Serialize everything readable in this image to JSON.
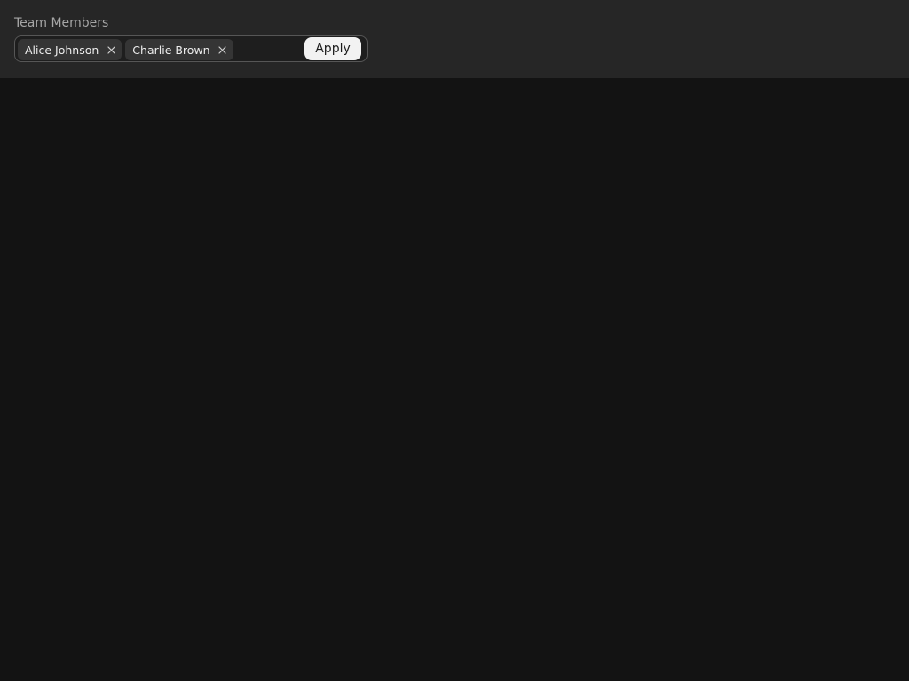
{
  "filter": {
    "label": "Team Members",
    "tags": [
      {
        "label": "Alice Johnson",
        "remove_icon": "close-icon"
      },
      {
        "label": "Charlie Brown",
        "remove_icon": "close-icon"
      }
    ],
    "input_value": "",
    "input_placeholder": "",
    "apply_label": "Apply"
  },
  "colors": {
    "page_background": "#131313",
    "panel_background": "#262626",
    "chip_background": "#353535",
    "button_background": "#f2f2f2"
  }
}
